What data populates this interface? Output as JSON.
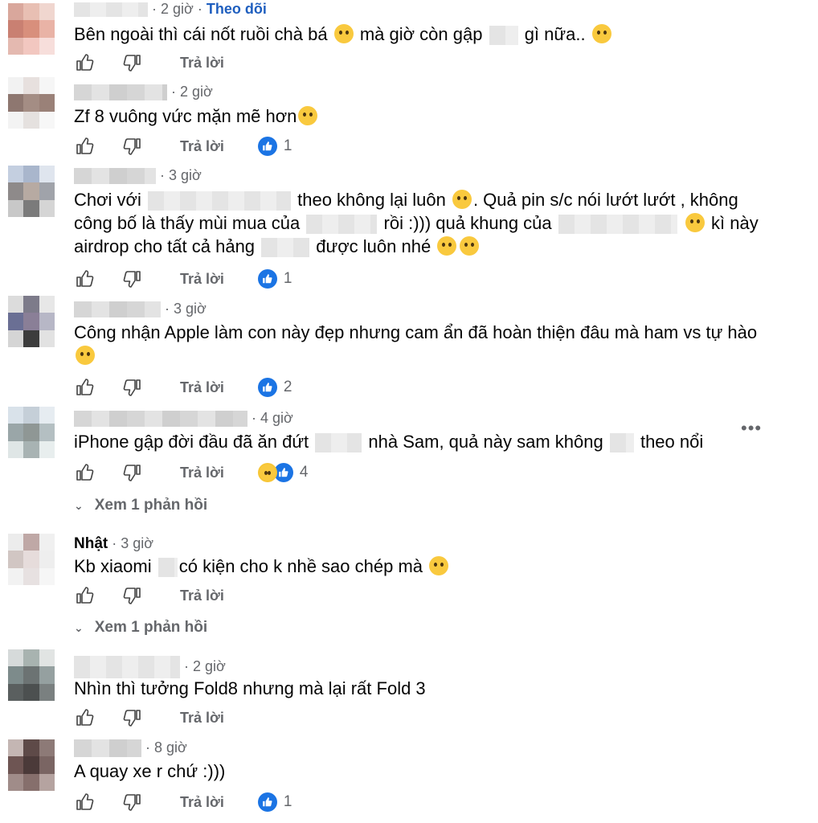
{
  "reply_label": "Trả lời",
  "more_replies_label": "Xem 1 phản hồi",
  "comments": [
    {
      "name": "",
      "time": "2 giờ",
      "follow": "Theo dõi",
      "text_a": "Bên ngoài thì cái nốt ruồi chà bá",
      "text_b": "mà giờ còn gập",
      "text_c": "gì nữa..",
      "reactions": ""
    },
    {
      "name": "",
      "time": "2 giờ",
      "text_a": "Zf 8 vuông vức mặn mẽ hơn",
      "reactions": "1"
    },
    {
      "name": "",
      "time": "3 giờ",
      "text_a": "Chơi với",
      "text_b": "theo không lại luôn",
      "text_c": ". Quả pin s/c nói lướt lướt , không",
      "text_d": "công bố là thấy mùi mua của",
      "text_e": "rồi :))) quả khung của",
      "text_f": "kì này",
      "text_g": "airdrop cho tất cả hảng",
      "text_h": "được luôn nhé",
      "reactions": "1"
    },
    {
      "name": "",
      "time": "3 giờ",
      "text_a": "Công nhận Apple làm con này đẹp nhưng cam ẩn đã hoàn thiện đâu mà ham vs tự hào",
      "reactions": "2"
    },
    {
      "name": "",
      "time": "4 giờ",
      "text_a": "iPhone gập đời đầu đã ăn đứt",
      "text_b": "nhà Sam, quả này sam không",
      "text_c": "theo nổi",
      "reactions": "4"
    },
    {
      "name": "Nhật",
      "time": "3 giờ",
      "text_a": "Kb xiaomi",
      "text_b": "có kiện cho k nhề sao chép mà",
      "reactions": ""
    },
    {
      "name": "",
      "time": "2 giờ",
      "text_a": "Nhìn thì tưởng Fold8 nhưng mà lại rất Fold 3",
      "reactions": ""
    },
    {
      "name": "",
      "time": "8 giờ",
      "text_a": "A quay xe r chứ :)))",
      "reactions": "1"
    }
  ],
  "icons": {
    "like": "thumbs-up-icon",
    "dislike": "thumbs-down-icon",
    "reaction_like": "like-reaction-icon",
    "reaction_haha": "haha-reaction-icon",
    "more": "more-options-icon",
    "chevron": "chevron-down-icon"
  },
  "colors": {
    "follow": "#1f5fbf",
    "like_badge": "#1b74e4",
    "muted": "#65676b"
  }
}
